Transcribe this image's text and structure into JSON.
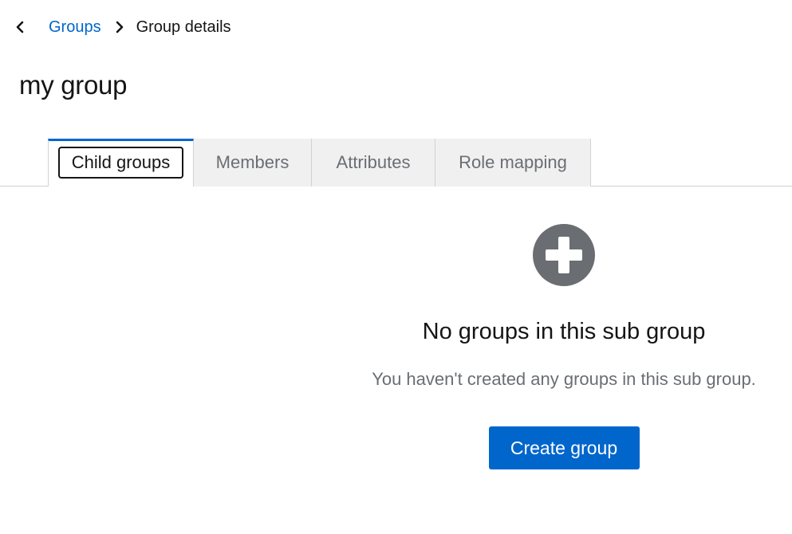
{
  "breadcrumb": {
    "back_icon": "chevron-left-icon",
    "parent": "Groups",
    "separator_icon": "chevron-right-icon",
    "current": "Group details"
  },
  "page": {
    "title": "my group"
  },
  "tabs": [
    {
      "label": "Child groups",
      "active": true
    },
    {
      "label": "Members",
      "active": false
    },
    {
      "label": "Attributes",
      "active": false
    },
    {
      "label": "Role mapping",
      "active": false
    }
  ],
  "empty_state": {
    "icon": "plus-circle-icon",
    "title": "No groups in this sub group",
    "body": "You haven't created any groups in this sub group.",
    "action_label": "Create group"
  },
  "colors": {
    "link": "#0066cc",
    "primary_button": "#0066cc",
    "active_tab_border": "#0066cc",
    "inactive_tab_bg": "#f0f0f0",
    "icon_gray": "#6a6e73"
  }
}
